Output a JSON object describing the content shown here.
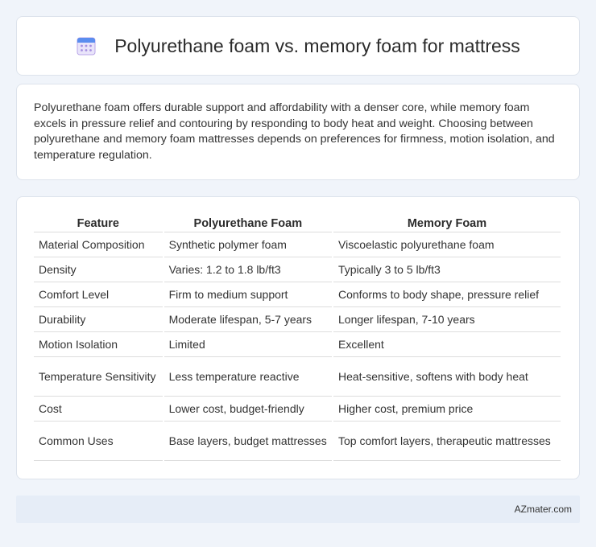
{
  "header": {
    "icon": "calendar-icon",
    "title": "Polyurethane foam vs. memory foam for mattress"
  },
  "summary": {
    "text": "Polyurethane foam offers durable support and affordability with a denser core, while memory foam excels in pressure relief and contouring by responding to body heat and weight. Choosing between polyurethane and memory foam mattresses depends on preferences for firmness, motion isolation, and temperature regulation."
  },
  "table": {
    "headers": [
      "Feature",
      "Polyurethane Foam",
      "Memory Foam"
    ],
    "rows": [
      [
        "Material Composition",
        "Synthetic polymer foam",
        "Viscoelastic polyurethane foam"
      ],
      [
        "Density",
        "Varies: 1.2 to 1.8 lb/ft3",
        "Typically 3 to 5 lb/ft3"
      ],
      [
        "Comfort Level",
        "Firm to medium support",
        "Conforms to body shape, pressure relief"
      ],
      [
        "Durability",
        "Moderate lifespan, 5-7 years",
        "Longer lifespan, 7-10 years"
      ],
      [
        "Motion Isolation",
        "Limited",
        "Excellent"
      ],
      [
        "Temperature Sensitivity",
        "Less temperature reactive",
        "Heat-sensitive, softens with body heat"
      ],
      [
        "Cost",
        "Lower cost, budget-friendly",
        "Higher cost, premium price"
      ],
      [
        "Common Uses",
        "Base layers, budget mattresses",
        "Top comfort layers, therapeutic mattresses"
      ]
    ]
  },
  "footer": {
    "text": "AZmater.com"
  },
  "colors": {
    "page_background": "#f0f4fa",
    "card_background": "#ffffff",
    "footer_background": "#e6edf7",
    "icon_blue": "#5b8def",
    "icon_purple": "#b9a6e8"
  }
}
